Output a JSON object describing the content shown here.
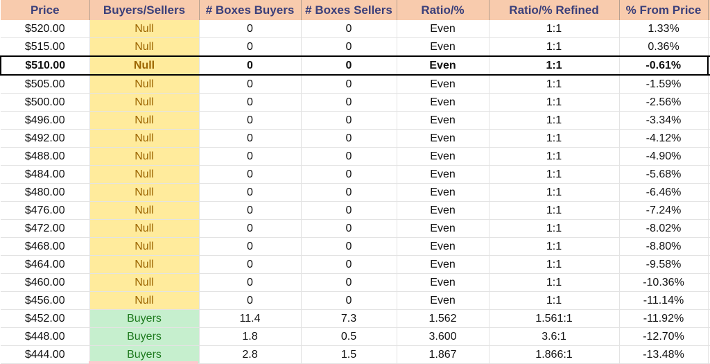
{
  "table": {
    "columns": [
      "Price",
      "Buyers/Sellers",
      "# Boxes Buyers",
      "# Boxes Sellers",
      "Ratio/%",
      "Ratio/% Refined",
      "% From Price"
    ],
    "current_price_row_index": 2,
    "status_colors": {
      "Null": "#ffeb9c",
      "Buyers": "#c6efce",
      "Sellers": "#ffc7ce"
    },
    "rows": [
      {
        "price": "$520.00",
        "side": "Null",
        "boxes_buyers": "0",
        "boxes_sellers": "0",
        "ratio": "Even",
        "ratio_refined": "1:1",
        "pct_from_price": "1.33%"
      },
      {
        "price": "$515.00",
        "side": "Null",
        "boxes_buyers": "0",
        "boxes_sellers": "0",
        "ratio": "Even",
        "ratio_refined": "1:1",
        "pct_from_price": "0.36%"
      },
      {
        "price": "$510.00",
        "side": "Null",
        "boxes_buyers": "0",
        "boxes_sellers": "0",
        "ratio": "Even",
        "ratio_refined": "1:1",
        "pct_from_price": "-0.61%"
      },
      {
        "price": "$505.00",
        "side": "Null",
        "boxes_buyers": "0",
        "boxes_sellers": "0",
        "ratio": "Even",
        "ratio_refined": "1:1",
        "pct_from_price": "-1.59%"
      },
      {
        "price": "$500.00",
        "side": "Null",
        "boxes_buyers": "0",
        "boxes_sellers": "0",
        "ratio": "Even",
        "ratio_refined": "1:1",
        "pct_from_price": "-2.56%"
      },
      {
        "price": "$496.00",
        "side": "Null",
        "boxes_buyers": "0",
        "boxes_sellers": "0",
        "ratio": "Even",
        "ratio_refined": "1:1",
        "pct_from_price": "-3.34%"
      },
      {
        "price": "$492.00",
        "side": "Null",
        "boxes_buyers": "0",
        "boxes_sellers": "0",
        "ratio": "Even",
        "ratio_refined": "1:1",
        "pct_from_price": "-4.12%"
      },
      {
        "price": "$488.00",
        "side": "Null",
        "boxes_buyers": "0",
        "boxes_sellers": "0",
        "ratio": "Even",
        "ratio_refined": "1:1",
        "pct_from_price": "-4.90%"
      },
      {
        "price": "$484.00",
        "side": "Null",
        "boxes_buyers": "0",
        "boxes_sellers": "0",
        "ratio": "Even",
        "ratio_refined": "1:1",
        "pct_from_price": "-5.68%"
      },
      {
        "price": "$480.00",
        "side": "Null",
        "boxes_buyers": "0",
        "boxes_sellers": "0",
        "ratio": "Even",
        "ratio_refined": "1:1",
        "pct_from_price": "-6.46%"
      },
      {
        "price": "$476.00",
        "side": "Null",
        "boxes_buyers": "0",
        "boxes_sellers": "0",
        "ratio": "Even",
        "ratio_refined": "1:1",
        "pct_from_price": "-7.24%"
      },
      {
        "price": "$472.00",
        "side": "Null",
        "boxes_buyers": "0",
        "boxes_sellers": "0",
        "ratio": "Even",
        "ratio_refined": "1:1",
        "pct_from_price": "-8.02%"
      },
      {
        "price": "$468.00",
        "side": "Null",
        "boxes_buyers": "0",
        "boxes_sellers": "0",
        "ratio": "Even",
        "ratio_refined": "1:1",
        "pct_from_price": "-8.80%"
      },
      {
        "price": "$464.00",
        "side": "Null",
        "boxes_buyers": "0",
        "boxes_sellers": "0",
        "ratio": "Even",
        "ratio_refined": "1:1",
        "pct_from_price": "-9.58%"
      },
      {
        "price": "$460.00",
        "side": "Null",
        "boxes_buyers": "0",
        "boxes_sellers": "0",
        "ratio": "Even",
        "ratio_refined": "1:1",
        "pct_from_price": "-10.36%"
      },
      {
        "price": "$456.00",
        "side": "Null",
        "boxes_buyers": "0",
        "boxes_sellers": "0",
        "ratio": "Even",
        "ratio_refined": "1:1",
        "pct_from_price": "-11.14%"
      },
      {
        "price": "$452.00",
        "side": "Buyers",
        "boxes_buyers": "11.4",
        "boxes_sellers": "7.3",
        "ratio": "1.562",
        "ratio_refined": "1.561:1",
        "pct_from_price": "-11.92%"
      },
      {
        "price": "$448.00",
        "side": "Buyers",
        "boxes_buyers": "1.8",
        "boxes_sellers": "0.5",
        "ratio": "3.600",
        "ratio_refined": "3.6:1",
        "pct_from_price": "-12.70%"
      },
      {
        "price": "$444.00",
        "side": "Buyers",
        "boxes_buyers": "2.8",
        "boxes_sellers": "1.5",
        "ratio": "1.867",
        "ratio_refined": "1.866:1",
        "pct_from_price": "-13.48%"
      }
    ]
  }
}
